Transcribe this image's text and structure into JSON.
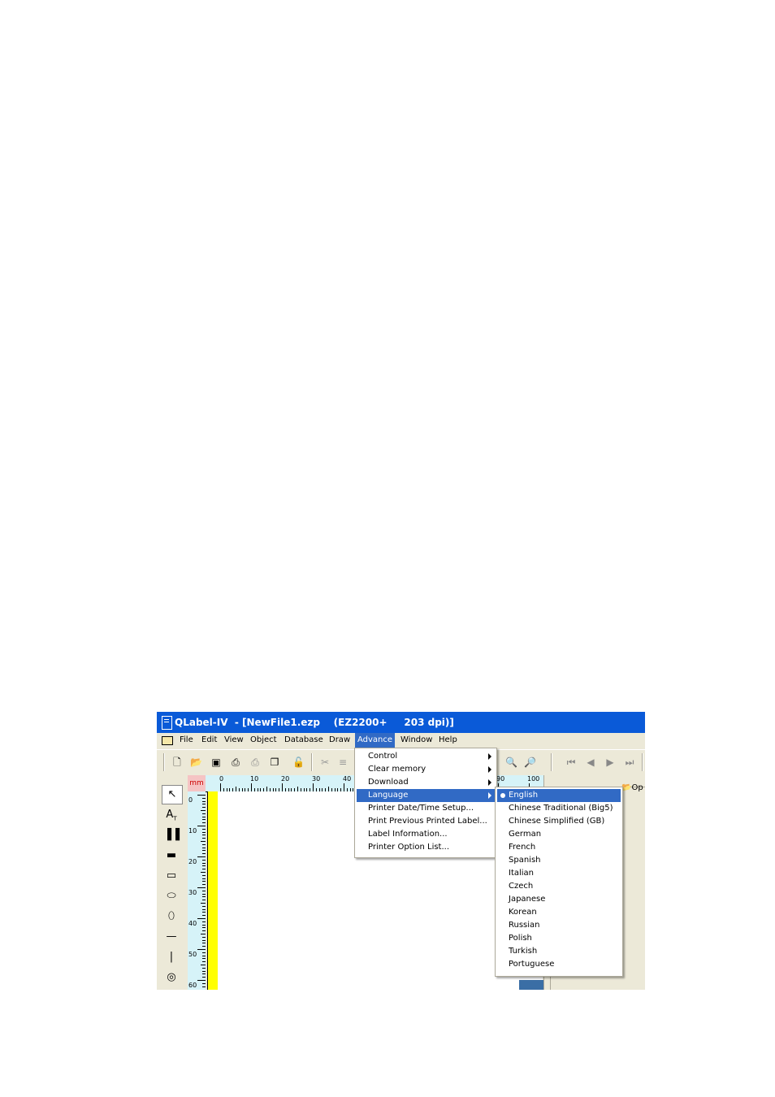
{
  "window": {
    "title": "QLabel-IV  - [NewFile1.ezp    (EZ2200+     203 dpi)]"
  },
  "menubar": {
    "items": [
      "File",
      "Edit",
      "View",
      "Object",
      "Database",
      "Draw",
      "Advance",
      "Window",
      "Help"
    ],
    "active": "Advance"
  },
  "toolbar": {
    "icons": [
      "new-file-icon",
      "open-folder-icon",
      "save-icon",
      "print-icon",
      "print-preview-icon",
      "copy-icon",
      "lock-icon",
      "cut-icon",
      "paste-icon",
      "zoom-out-icon",
      "zoom-in-icon",
      "first-page-icon",
      "prev-page-icon",
      "next-page-icon",
      "last-page-icon"
    ]
  },
  "tools": [
    "select-arrow-icon",
    "text-tool-icon",
    "barcode-tool-icon",
    "filled-rect-icon",
    "rect-icon",
    "rounded-rect-icon",
    "ellipse-icon",
    "hline-icon",
    "vline-icon",
    "image-tool-icon"
  ],
  "ruler": {
    "unit": "mm",
    "top_labels": [
      "0",
      "10",
      "20",
      "30",
      "40",
      "90",
      "100"
    ],
    "left_labels": [
      "0",
      "10",
      "20",
      "30",
      "40",
      "50",
      "60"
    ]
  },
  "right_panel": {
    "button_label": "Op"
  },
  "advance_menu": [
    {
      "label": "Control",
      "submenu": true
    },
    {
      "label": "Clear memory",
      "submenu": true
    },
    {
      "label": "Download",
      "submenu": true
    },
    {
      "label": "Language",
      "submenu": true,
      "highlighted": true
    },
    {
      "label": "Printer Date/Time Setup...",
      "submenu": false
    },
    {
      "label": "Print Previous Printed Label...",
      "submenu": false
    },
    {
      "label": "Label Information...",
      "submenu": false
    },
    {
      "label": "Printer Option List...",
      "submenu": false
    }
  ],
  "language_menu": {
    "selected": "English",
    "items": [
      "English",
      "Chinese Traditional (Big5)",
      "Chinese Simplified (GB)",
      "German",
      "French",
      "Spanish",
      "Italian",
      "Czech",
      "Japanese",
      "Korean",
      "Russian",
      "Polish",
      "Turkish",
      "Portuguese"
    ]
  },
  "colors": {
    "titlebar": "#0a5ad8",
    "highlight": "#316ac5",
    "ruler": "#d6f3f8",
    "margin": "#ffff00"
  }
}
